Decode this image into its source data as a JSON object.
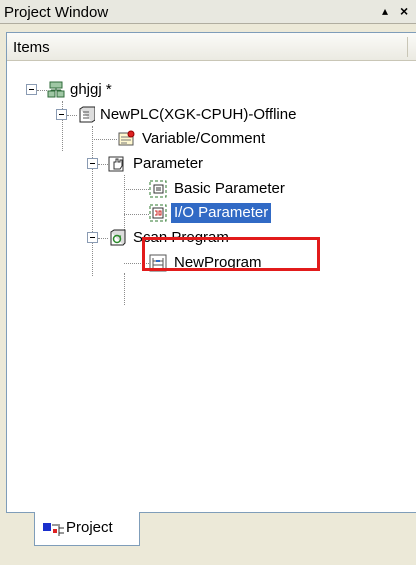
{
  "window": {
    "title": "Project Window",
    "up_glyph": "▴",
    "close_glyph": "×"
  },
  "header": {
    "label": "Items"
  },
  "tree": {
    "root": "ghjgj *",
    "plc": "NewPLC(XGK-CPUH)-Offline",
    "variable": "Variable/Comment",
    "parameter": "Parameter",
    "basic_parameter": "Basic Parameter",
    "io_parameter": "I/O Parameter",
    "scan_program": "Scan Program",
    "new_program": "NewProgram"
  },
  "tabs": [
    {
      "label": "Project"
    }
  ],
  "colors": {
    "selection": "#316ac5",
    "highlight": "#e21b1b",
    "border": "#7f9db9"
  },
  "icons": {
    "root": "network-project-icon",
    "plc": "plc-module-icon",
    "variable": "variable-comment-icon",
    "parameter": "parameter-hand-icon",
    "basic_parameter": "basic-parameter-icon",
    "io_parameter": "io-parameter-icon",
    "scan_program": "scan-program-icon",
    "new_program": "program-ladder-icon",
    "tab": "project-tab-icon"
  }
}
